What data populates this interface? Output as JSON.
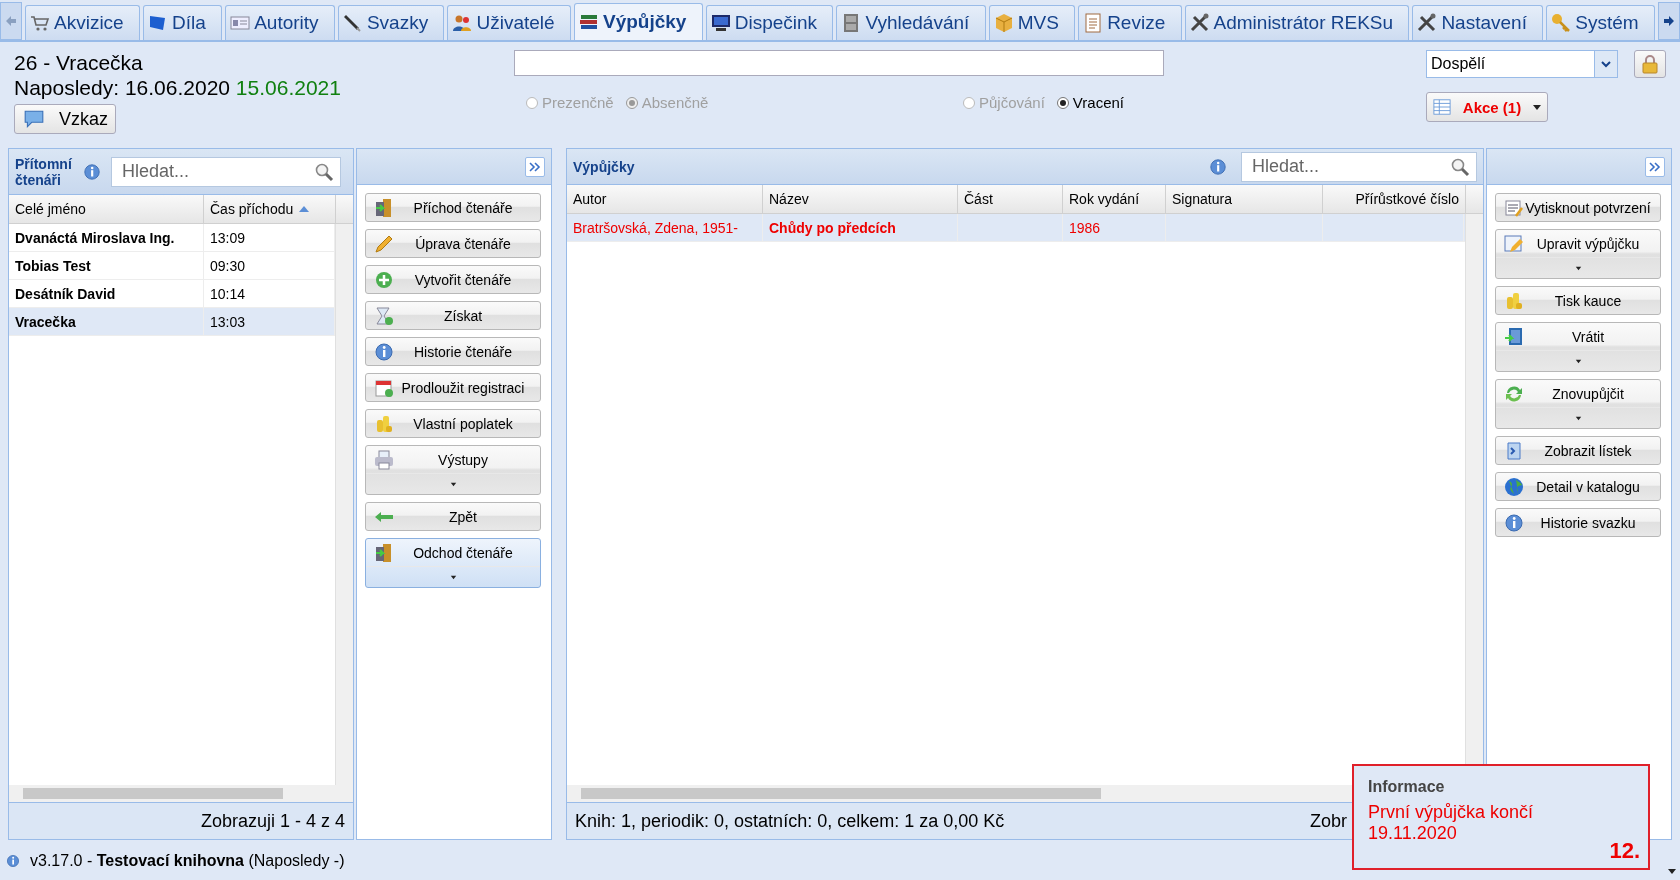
{
  "tabs": [
    {
      "label": "Akvizice",
      "selected": false
    },
    {
      "label": "Díla",
      "selected": false
    },
    {
      "label": "Autority",
      "selected": false
    },
    {
      "label": "Svazky",
      "selected": false
    },
    {
      "label": "Uživatelé",
      "selected": false
    },
    {
      "label": "Výpůjčky",
      "selected": true
    },
    {
      "label": "Dispečink",
      "selected": false
    },
    {
      "label": "Vyhledávání",
      "selected": false
    },
    {
      "label": "MVS",
      "selected": false
    },
    {
      "label": "Revize",
      "selected": false
    },
    {
      "label": "Administrátor REKSu",
      "selected": false
    },
    {
      "label": "Nastavení",
      "selected": false
    },
    {
      "label": "Systém",
      "selected": false
    }
  ],
  "reader": {
    "title": "26 - Vracečka",
    "last_visit_label": "Naposledy:",
    "last_visit": "16.06.2020",
    "valid_until": "15.06.2021",
    "message_button": "Vzkaz"
  },
  "loan_type": [
    {
      "label": "Prezenčně",
      "selected": false,
      "disabled": true
    },
    {
      "label": "Absenčně",
      "selected": true,
      "disabled": true
    }
  ],
  "mode": [
    {
      "label": "Půjčování",
      "selected": false,
      "disabled": true
    },
    {
      "label": "Vracení",
      "selected": true,
      "disabled": false
    }
  ],
  "category_select": {
    "value": "Dospělí"
  },
  "actions_button": {
    "label": "Akce (1)"
  },
  "readers_panel": {
    "title": "Přítomní čtenáři",
    "search": {
      "placeholder": "Hledat..."
    },
    "columns": [
      {
        "label": "Celé jméno",
        "sorted": false
      },
      {
        "label": "Čas příchodu",
        "sorted": true
      }
    ],
    "rows": [
      {
        "name": "Dvanáctá Miroslava Ing.",
        "time": "13:09",
        "selected": false
      },
      {
        "name": "Tobias Test",
        "time": "09:30",
        "selected": false
      },
      {
        "name": "Desátník David",
        "time": "10:14",
        "selected": false
      },
      {
        "name": "Vracečka",
        "time": "13:03",
        "selected": true
      }
    ],
    "footer": "Zobrazuji 1 - 4 z 4"
  },
  "reader_actions": [
    {
      "label": "Příchod čtenáře",
      "kind": "plain",
      "focused": false
    },
    {
      "label": "Úprava čtenáře",
      "kind": "plain",
      "focused": false
    },
    {
      "label": "Vytvořit čtenáře",
      "kind": "plain",
      "focused": false
    },
    {
      "label": "Získat",
      "kind": "plain",
      "focused": false
    },
    {
      "label": "Historie čtenáře",
      "kind": "plain",
      "focused": false
    },
    {
      "label": "Prodloužit registraci",
      "kind": "plain",
      "focused": false
    },
    {
      "label": "Vlastní poplatek",
      "kind": "plain",
      "focused": false
    },
    {
      "label": "Výstupy",
      "kind": "split",
      "focused": false
    },
    {
      "label": "Zpět",
      "kind": "plain",
      "focused": false
    },
    {
      "label": "Odchod čtenáře",
      "kind": "split",
      "focused": true
    }
  ],
  "loans_panel": {
    "title": "Výpůjčky",
    "search": {
      "placeholder": "Hledat..."
    },
    "columns": [
      "Autor",
      "Název",
      "Část",
      "Rok vydání",
      "Signatura",
      "Přírůstkové číslo"
    ],
    "rows": [
      {
        "author": "Bratršovská, Zdena, 1951-",
        "title": "Chůdy po předcích",
        "year": "1986",
        "warning": true,
        "selected": true
      }
    ],
    "summary": "Knih: 1, periodik: 0, ostatních: 0, celkem: 1 za 0,00 Kč",
    "footer_right": "Zobr"
  },
  "loan_actions": [
    {
      "label": "Vytisknout potvrzení",
      "kind": "plain"
    },
    {
      "label": "Upravit výpůjčku",
      "kind": "split"
    },
    {
      "label": "Tisk kauce",
      "kind": "plain"
    },
    {
      "label": "Vrátit",
      "kind": "split"
    },
    {
      "label": "Znovupůjčit",
      "kind": "split"
    },
    {
      "label": "Zobrazit lístek",
      "kind": "plain"
    },
    {
      "label": "Detail v katalogu",
      "kind": "plain"
    },
    {
      "label": "Historie svazku",
      "kind": "plain"
    }
  ],
  "notification": {
    "title": "Informace",
    "message": "První výpůjčka končí 19.11.2020",
    "count": "12."
  },
  "status_bar": {
    "text": "v3.17.0 - **Testovací knihovna** (Naposledy -)"
  }
}
